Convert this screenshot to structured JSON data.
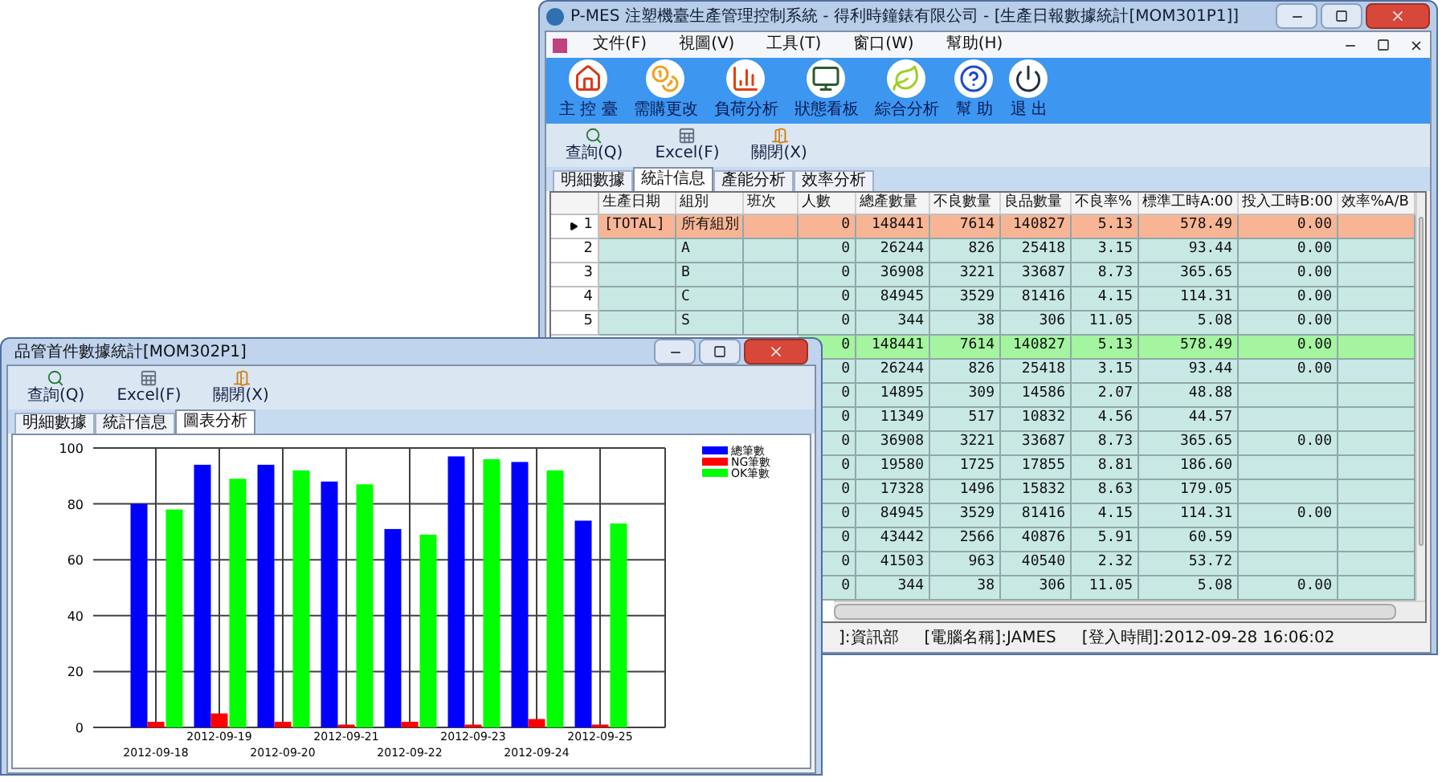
{
  "main_window": {
    "title": "P-MES 注塑機臺生產管理控制系統 - 得利時鐘錶有限公司 - [生產日報數據統計[MOM301P1]]",
    "menu": [
      {
        "label": "文件(F)"
      },
      {
        "label": "視圖(V)"
      },
      {
        "label": "工具(T)"
      },
      {
        "label": "窗口(W)"
      },
      {
        "label": "幫助(H)"
      }
    ],
    "toolbar": [
      {
        "label": "主 控 臺",
        "kind": "home"
      },
      {
        "label": "需購更改",
        "kind": "coin"
      },
      {
        "label": "負荷分析",
        "kind": "chart"
      },
      {
        "label": "狀態看板",
        "kind": "monitor"
      },
      {
        "label": "綜合分析",
        "kind": "leaf"
      },
      {
        "label": "幫 助",
        "kind": "help"
      },
      {
        "label": "退 出",
        "kind": "power"
      }
    ],
    "actions": [
      {
        "label": "查詢(Q)",
        "kind": "search"
      },
      {
        "label": "Excel(F)",
        "kind": "excel"
      },
      {
        "label": "關閉(X)",
        "kind": "close"
      }
    ],
    "tabs": [
      {
        "label": "明細數據",
        "selected": false
      },
      {
        "label": "統計信息",
        "selected": true
      },
      {
        "label": "產能分析",
        "selected": false
      },
      {
        "label": "效率分析",
        "selected": false
      }
    ],
    "table": {
      "columns": [
        "生產日期",
        "組別",
        "班次",
        "人數",
        "總產數量",
        "不良數量",
        "良品數量",
        "不良率%",
        "標準工時A:00",
        "投入工時B:00",
        "效率%A/B"
      ],
      "rows": [
        {
          "no": "1",
          "selected": true,
          "color": "#f8b595",
          "cells": [
            "[TOTAL]",
            "所有組別",
            null,
            "0",
            "148441",
            "7614",
            "140827",
            "5.13",
            "578.49",
            "0.00",
            null
          ]
        },
        {
          "no": "2",
          "selected": false,
          "color": "#c8e8e4",
          "cells": [
            null,
            "A",
            null,
            "0",
            "26244",
            "826",
            "25418",
            "3.15",
            "93.44",
            "0.00",
            null
          ]
        },
        {
          "no": "3",
          "selected": false,
          "color": "#c8e8e4",
          "cells": [
            null,
            "B",
            null,
            "0",
            "36908",
            "3221",
            "33687",
            "8.73",
            "365.65",
            "0.00",
            null
          ]
        },
        {
          "no": "4",
          "selected": false,
          "color": "#c8e8e4",
          "cells": [
            null,
            "C",
            null,
            "0",
            "84945",
            "3529",
            "81416",
            "4.15",
            "114.31",
            "0.00",
            null
          ]
        },
        {
          "no": "5",
          "selected": false,
          "color": "#c8e8e4",
          "cells": [
            null,
            "S",
            null,
            "0",
            "344",
            "38",
            "306",
            "11.05",
            "5.08",
            "0.00",
            null
          ]
        },
        {
          "color": "#a4f4a0",
          "cells": [
            null,
            null,
            null,
            "0",
            "148441",
            "7614",
            "140827",
            "5.13",
            "578.49",
            "0.00",
            null
          ]
        },
        {
          "color": "#c8e8e4",
          "cells": [
            null,
            null,
            null,
            "0",
            "26244",
            "826",
            "25418",
            "3.15",
            "93.44",
            "0.00",
            null
          ]
        },
        {
          "color": "#c8e8e4",
          "cells": [
            null,
            null,
            null,
            "0",
            "14895",
            "309",
            "14586",
            "2.07",
            "48.88",
            null,
            null
          ]
        },
        {
          "color": "#c8e8e4",
          "cells": [
            null,
            null,
            null,
            "0",
            "11349",
            "517",
            "10832",
            "4.56",
            "44.57",
            null,
            null
          ]
        },
        {
          "color": "#c8e8e4",
          "cells": [
            null,
            null,
            null,
            "0",
            "36908",
            "3221",
            "33687",
            "8.73",
            "365.65",
            "0.00",
            null
          ]
        },
        {
          "color": "#c8e8e4",
          "cells": [
            null,
            null,
            null,
            "0",
            "19580",
            "1725",
            "17855",
            "8.81",
            "186.60",
            null,
            null
          ]
        },
        {
          "color": "#c8e8e4",
          "cells": [
            null,
            null,
            null,
            "0",
            "17328",
            "1496",
            "15832",
            "8.63",
            "179.05",
            null,
            null
          ]
        },
        {
          "color": "#c8e8e4",
          "cells": [
            null,
            null,
            null,
            "0",
            "84945",
            "3529",
            "81416",
            "4.15",
            "114.31",
            "0.00",
            null
          ]
        },
        {
          "color": "#c8e8e4",
          "cells": [
            null,
            null,
            null,
            "0",
            "43442",
            "2566",
            "40876",
            "5.91",
            "60.59",
            null,
            null
          ]
        },
        {
          "color": "#c8e8e4",
          "cells": [
            null,
            null,
            null,
            "0",
            "41503",
            "963",
            "40540",
            "2.32",
            "53.72",
            null,
            null
          ]
        },
        {
          "color": "#c8e8e4",
          "cells": [
            null,
            null,
            null,
            "0",
            "344",
            "38",
            "306",
            "11.05",
            "5.08",
            "0.00",
            null
          ]
        }
      ]
    },
    "status_bar": [
      "]:資訊部",
      "[電腦名稱]:JAMES",
      "[登入時間]:2012-09-28 16:06:02"
    ]
  },
  "chart_window": {
    "title": "品管首件數據統計[MOM302P1]",
    "actions": [
      {
        "label": "查詢(Q)",
        "kind": "search"
      },
      {
        "label": "Excel(F)",
        "kind": "excel"
      },
      {
        "label": "關閉(X)",
        "kind": "close"
      }
    ],
    "tabs": [
      {
        "label": "明細數據",
        "selected": false
      },
      {
        "label": "統計信息",
        "selected": false
      },
      {
        "label": "圖表分析",
        "selected": true
      }
    ],
    "chart_data": {
      "type": "bar",
      "categories": [
        "2012-09-18",
        "2012-09-19",
        "2012-09-20",
        "2012-09-21",
        "2012-09-22",
        "2012-09-23",
        "2012-09-24",
        "2012-09-25"
      ],
      "ylim": [
        0,
        100
      ],
      "yticks": [
        0,
        20,
        40,
        60,
        80,
        100
      ],
      "grid": true,
      "legend": true,
      "series": [
        {
          "name": "總筆數",
          "color": "#0000ff",
          "values": [
            80,
            94,
            94,
            88,
            71,
            97,
            95,
            74
          ]
        },
        {
          "name": "NG筆數",
          "color": "#ff0000",
          "values": [
            2,
            5,
            2,
            1,
            2,
            1,
            3,
            1
          ]
        },
        {
          "name": "OK筆數",
          "color": "#00ff00",
          "values": [
            78,
            89,
            92,
            87,
            69,
            96,
            92,
            73
          ]
        }
      ]
    }
  }
}
